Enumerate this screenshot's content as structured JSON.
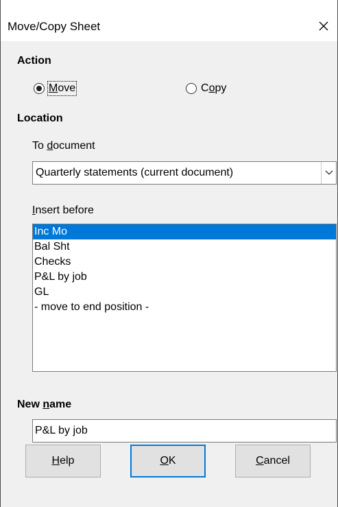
{
  "window": {
    "title": "Move/Copy Sheet"
  },
  "action": {
    "heading": "Action",
    "move_label": "Move",
    "move_selected": true,
    "copy_label": "Copy",
    "copy_selected": false
  },
  "location": {
    "heading": "Location",
    "to_document_label": "To document",
    "to_document_value": "Quarterly statements (current document)",
    "insert_before_label": "Insert before",
    "items": [
      {
        "label": "Inc Mo",
        "selected": true
      },
      {
        "label": "Bal Sht",
        "selected": false
      },
      {
        "label": "Checks",
        "selected": false
      },
      {
        "label": "P&L by job",
        "selected": false
      },
      {
        "label": "GL",
        "selected": false
      },
      {
        "label": "- move to end position -",
        "selected": false
      }
    ]
  },
  "new_name": {
    "heading": "New name",
    "value": "P&L by job"
  },
  "buttons": {
    "help": "Help",
    "ok": "OK",
    "cancel": "Cancel"
  },
  "icons": {
    "close": "close-icon",
    "dropdown": "chevron-down-icon"
  }
}
